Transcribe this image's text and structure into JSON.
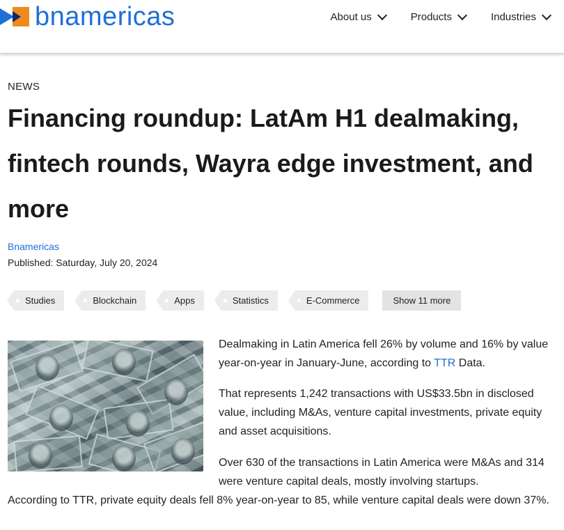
{
  "header": {
    "logo_text": "bnamericas",
    "brand_colors": {
      "blue": "#1f6fd8",
      "orange": "#f08a1c",
      "navy": "#0c2a6e"
    },
    "nav": [
      {
        "label": "About us",
        "icon": "chevron-down-icon"
      },
      {
        "label": "Products",
        "icon": "chevron-down-icon"
      },
      {
        "label": "Industries",
        "icon": "chevron-down-icon"
      }
    ]
  },
  "article": {
    "kicker": "NEWS",
    "title": "Financing roundup: LatAm H1 dealmaking, fintech rounds, Wayra edge investment, and more",
    "author": "Bnamericas",
    "published": "Published: Saturday, July 20, 2024",
    "tags": [
      "Studies",
      "Blockchain",
      "Apps",
      "Statistics",
      "E-Commerce"
    ],
    "show_more_label": "Show 11 more",
    "image_icon": "dollar-bills-image",
    "paragraphs": {
      "p1_before": "Dealmaking in Latin America fell 26% by volume and 16% by value year-on-year in January-June, according to ",
      "p1_link": "TTR",
      "p1_after": " Data.",
      "p2": "That represents 1,242 transactions with US$33.5bn in disclosed value, including M&As, venture capital investments, private equity and asset acquisitions.",
      "p3_part1": "Over 630 of the transactions in Latin America were M&As and 314 were venture capital deals, mostly involving startups.",
      "p3_part2": "According to TTR, private equity deals fell 8% year-on-year to 85, while venture capital deals were down 37%."
    }
  }
}
